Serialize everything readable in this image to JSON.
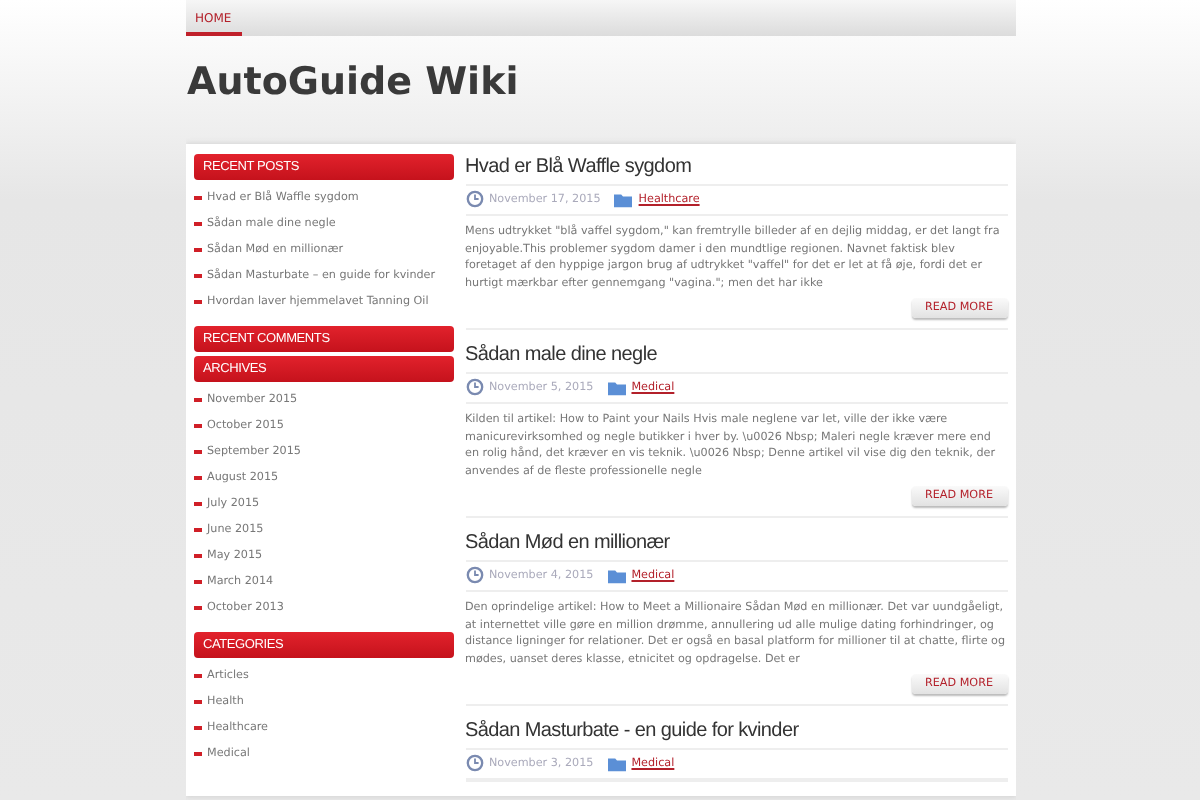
{
  "nav": [
    {
      "label": "HOME",
      "selected": true
    }
  ],
  "site_title": "AutoGuide Wiki",
  "sidebar": [
    {
      "title": "RECENT POSTS",
      "items": [
        "Hvad er Blå Waffle sygdom",
        "Sådan male dine negle",
        "Sådan Mød en millionær",
        "Sådan Masturbate – en guide for kvinder",
        "Hvordan laver hjemmelavet Tanning Oil"
      ]
    },
    {
      "title": "RECENT COMMENTS"
    },
    {
      "title": "ARCHIVES",
      "items": [
        "November 2015",
        "October 2015",
        "September 2015",
        "August 2015",
        "July 2015",
        "June 2015",
        "May 2015",
        "March 2014",
        "October 2013"
      ]
    },
    {
      "title": "CATEGORIES",
      "items": [
        "Articles",
        "Health",
        "Healthcare",
        "Medical"
      ]
    }
  ],
  "posts": [
    {
      "title": "Hvad er Blå Waffle sygdom",
      "date": "November 17, 2015",
      "category": "Healthcare",
      "excerpt": "Mens udtrykket \"blå vaffel sygdom,\" kan fremtrylle billeder af en dejlig middag, er det langt fra enjoyable.This problemer sygdom damer i den mundtlige regionen. Navnet faktisk blev foretaget af den hyppige jargon brug af udtrykket \"vaffel\" for det er let at få øje, fordi det er hurtigt mærkbar efter gennemgang \"vagina.\"; men det har ikke",
      "button": "READ MORE"
    },
    {
      "title": "Sådan male dine negle",
      "date": "November 5, 2015",
      "category": "Medical",
      "excerpt": "Kilden til artikel: How to Paint your Nails Hvis male neglene var let, ville der ikke være manicurevirksomhed og negle butikker i hver by. \\u0026 Nbsp; Maleri negle kræver mere end en rolig hånd, det kræver en vis teknik. \\u0026 Nbsp; Denne artikel vil vise dig den teknik, der anvendes af de fleste professionelle negle",
      "button": "READ MORE"
    },
    {
      "title": "Sådan Mød en millionær",
      "date": "November 4, 2015",
      "category": "Medical",
      "excerpt": "Den oprindelige artikel: How to Meet a Millionaire Sådan Mød en millionær. Det var uundgåeligt, at internettet ville gøre en million drømme, annullering ud alle mulige dating forhindringer, og distance ligninger for relationer. Det er også en basal platform for millioner til at chatte, flirte og mødes, uanset deres klasse, etnicitet og opdragelse. Det er",
      "button": "READ MORE"
    },
    {
      "title": "Sådan Masturbate - en guide for kvinder",
      "date": "November 3, 2015",
      "category": "Medical"
    }
  ]
}
